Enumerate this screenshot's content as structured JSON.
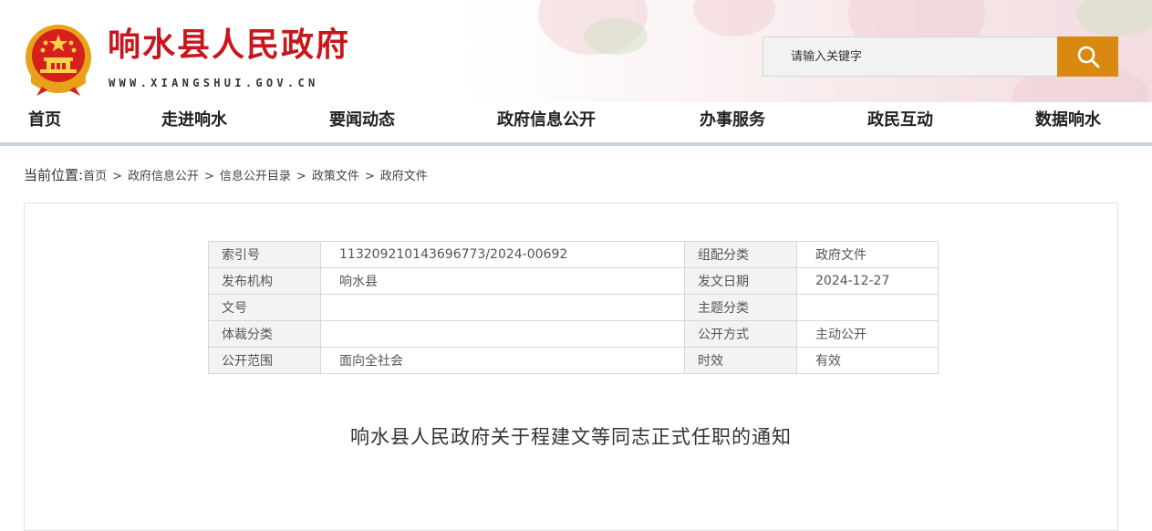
{
  "header": {
    "site_title": "响水县人民政府",
    "site_url": "WWW.XIANGSHUI.GOV.CN",
    "emblem_icon": "national-emblem-icon",
    "search": {
      "placeholder": "请输入关键字",
      "button_icon": "search-icon"
    },
    "colors": {
      "title_red": "#c8161d",
      "search_orange": "#d9890f"
    }
  },
  "nav": {
    "items": [
      {
        "label": "首页"
      },
      {
        "label": "走进响水"
      },
      {
        "label": "要闻动态"
      },
      {
        "label": "政府信息公开"
      },
      {
        "label": "办事服务"
      },
      {
        "label": "政民互动"
      },
      {
        "label": "数据响水"
      }
    ]
  },
  "breadcrumb": {
    "label": "当前位置:",
    "items": [
      "首页",
      "政府信息公开",
      "信息公开目录",
      "政策文件",
      "政府文件"
    ],
    "separator": ">"
  },
  "meta": {
    "rows": [
      {
        "l1": "索引号",
        "v1": "113209210143696773/2024-00692",
        "l2": "组配分类",
        "v2": "政府文件"
      },
      {
        "l1": "发布机构",
        "v1": "响水县",
        "l2": "发文日期",
        "v2": "2024-12-27"
      },
      {
        "l1": "文号",
        "v1": "",
        "l2": "主题分类",
        "v2": ""
      },
      {
        "l1": "体裁分类",
        "v1": "",
        "l2": "公开方式",
        "v2": "主动公开"
      },
      {
        "l1": "公开范围",
        "v1": "面向全社会",
        "l2": "时效",
        "v2": "有效"
      }
    ]
  },
  "document": {
    "title": "响水县人民政府关于程建文等同志正式任职的通知"
  }
}
